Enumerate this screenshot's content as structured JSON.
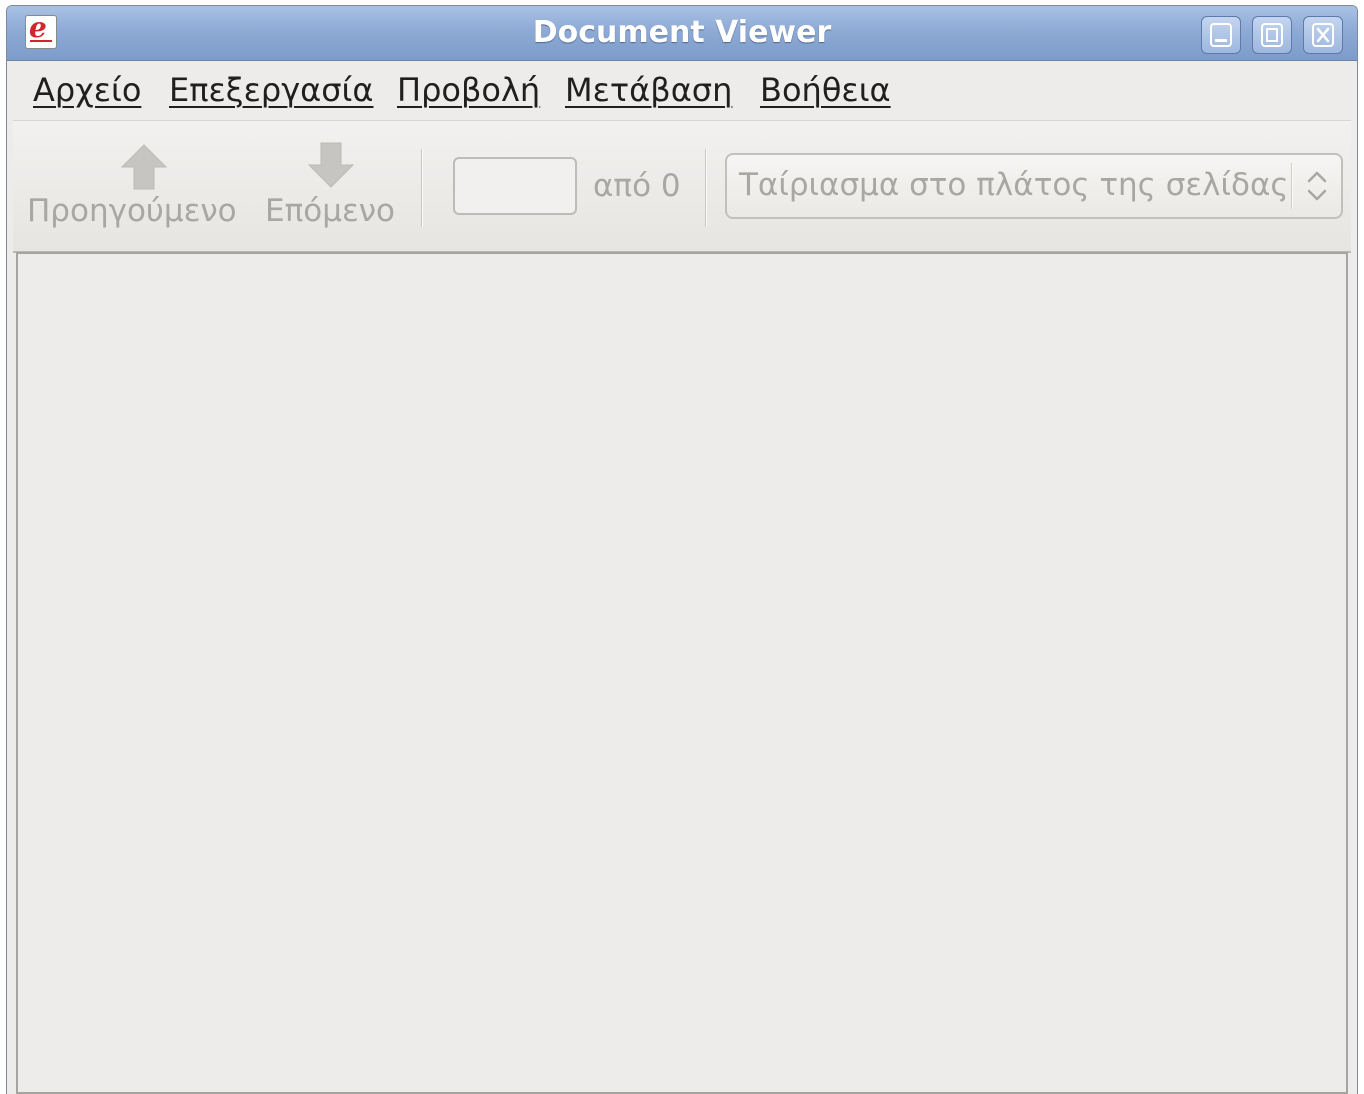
{
  "window": {
    "title": "Document Viewer",
    "app_icon": "evince-document-icon",
    "controls": [
      "minimize-icon",
      "maximize-icon",
      "close-icon"
    ]
  },
  "menubar": {
    "items": [
      {
        "label": "Αρχείο"
      },
      {
        "label": "Επεξεργασία"
      },
      {
        "label": "Προβολή"
      },
      {
        "label": "Μετάβαση"
      },
      {
        "label": "Βοήθεια"
      }
    ]
  },
  "toolbar": {
    "previous": {
      "label": "Προηγούμενο",
      "icon": "arrow-up-icon",
      "enabled": false
    },
    "next": {
      "label": "Επόμενο",
      "icon": "arrow-down-icon",
      "enabled": false
    },
    "page_entry": {
      "value": ""
    },
    "page_count_label": "από 0",
    "zoom": {
      "selected": "Ταίριασμα στο πλάτος της σελίδας",
      "icon": "updown-chevron-icon"
    }
  },
  "colors": {
    "titlebar": "#8eaad5",
    "window_bg": "#edecea",
    "disabled_text": "#a8a7a4"
  }
}
